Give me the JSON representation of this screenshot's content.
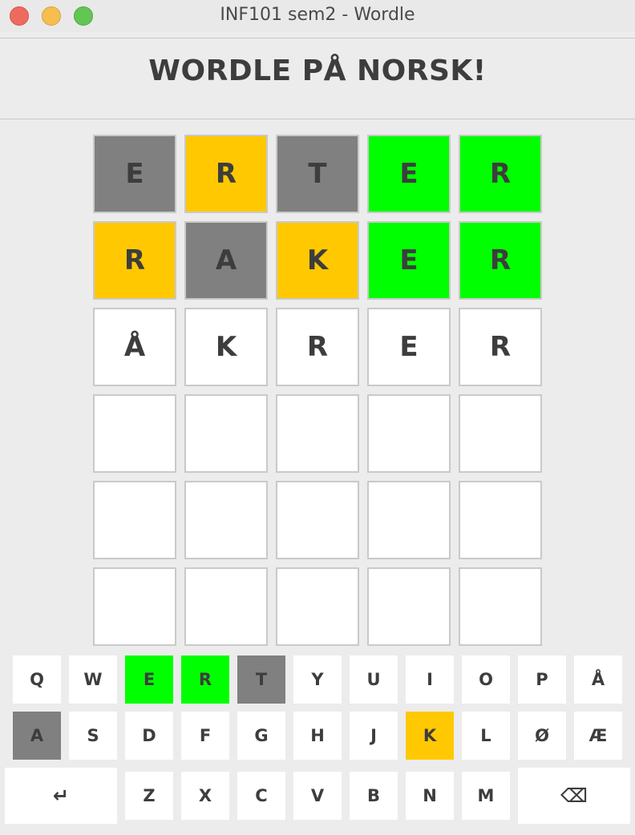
{
  "window": {
    "title": "INF101 sem2 - Wordle"
  },
  "header": {
    "title": "WORDLE PÅ NORSK!"
  },
  "colors": {
    "gray": "#808080",
    "yellow": "#ffc800",
    "green": "#00ff00",
    "empty": "#ffffff"
  },
  "board": {
    "rows": [
      [
        {
          "letter": "E",
          "state": "gray"
        },
        {
          "letter": "R",
          "state": "yellow"
        },
        {
          "letter": "T",
          "state": "gray"
        },
        {
          "letter": "E",
          "state": "green"
        },
        {
          "letter": "R",
          "state": "green"
        }
      ],
      [
        {
          "letter": "R",
          "state": "yellow"
        },
        {
          "letter": "A",
          "state": "gray"
        },
        {
          "letter": "K",
          "state": "yellow"
        },
        {
          "letter": "E",
          "state": "green"
        },
        {
          "letter": "R",
          "state": "green"
        }
      ],
      [
        {
          "letter": "Å",
          "state": "empty"
        },
        {
          "letter": "K",
          "state": "empty"
        },
        {
          "letter": "R",
          "state": "empty"
        },
        {
          "letter": "E",
          "state": "empty"
        },
        {
          "letter": "R",
          "state": "empty"
        }
      ],
      [
        {
          "letter": "",
          "state": "empty"
        },
        {
          "letter": "",
          "state": "empty"
        },
        {
          "letter": "",
          "state": "empty"
        },
        {
          "letter": "",
          "state": "empty"
        },
        {
          "letter": "",
          "state": "empty"
        }
      ],
      [
        {
          "letter": "",
          "state": "empty"
        },
        {
          "letter": "",
          "state": "empty"
        },
        {
          "letter": "",
          "state": "empty"
        },
        {
          "letter": "",
          "state": "empty"
        },
        {
          "letter": "",
          "state": "empty"
        }
      ],
      [
        {
          "letter": "",
          "state": "empty"
        },
        {
          "letter": "",
          "state": "empty"
        },
        {
          "letter": "",
          "state": "empty"
        },
        {
          "letter": "",
          "state": "empty"
        },
        {
          "letter": "",
          "state": "empty"
        }
      ]
    ]
  },
  "keyboard": {
    "rows": [
      [
        {
          "label": "Q",
          "state": "empty"
        },
        {
          "label": "W",
          "state": "empty"
        },
        {
          "label": "E",
          "state": "green"
        },
        {
          "label": "R",
          "state": "green"
        },
        {
          "label": "T",
          "state": "gray"
        },
        {
          "label": "Y",
          "state": "empty"
        },
        {
          "label": "U",
          "state": "empty"
        },
        {
          "label": "I",
          "state": "empty"
        },
        {
          "label": "O",
          "state": "empty"
        },
        {
          "label": "P",
          "state": "empty"
        },
        {
          "label": "Å",
          "state": "empty"
        }
      ],
      [
        {
          "label": "A",
          "state": "gray"
        },
        {
          "label": "S",
          "state": "empty"
        },
        {
          "label": "D",
          "state": "empty"
        },
        {
          "label": "F",
          "state": "empty"
        },
        {
          "label": "G",
          "state": "empty"
        },
        {
          "label": "H",
          "state": "empty"
        },
        {
          "label": "J",
          "state": "empty"
        },
        {
          "label": "K",
          "state": "yellow"
        },
        {
          "label": "L",
          "state": "empty"
        },
        {
          "label": "Ø",
          "state": "empty"
        },
        {
          "label": "Æ",
          "state": "empty"
        }
      ],
      [
        {
          "label": "↵",
          "state": "empty",
          "icon": "enter-icon"
        },
        {
          "label": "Z",
          "state": "empty"
        },
        {
          "label": "X",
          "state": "empty"
        },
        {
          "label": "C",
          "state": "empty"
        },
        {
          "label": "V",
          "state": "empty"
        },
        {
          "label": "B",
          "state": "empty"
        },
        {
          "label": "N",
          "state": "empty"
        },
        {
          "label": "M",
          "state": "empty"
        },
        {
          "label": "⌫",
          "state": "empty",
          "icon": "backspace-icon"
        }
      ]
    ]
  }
}
